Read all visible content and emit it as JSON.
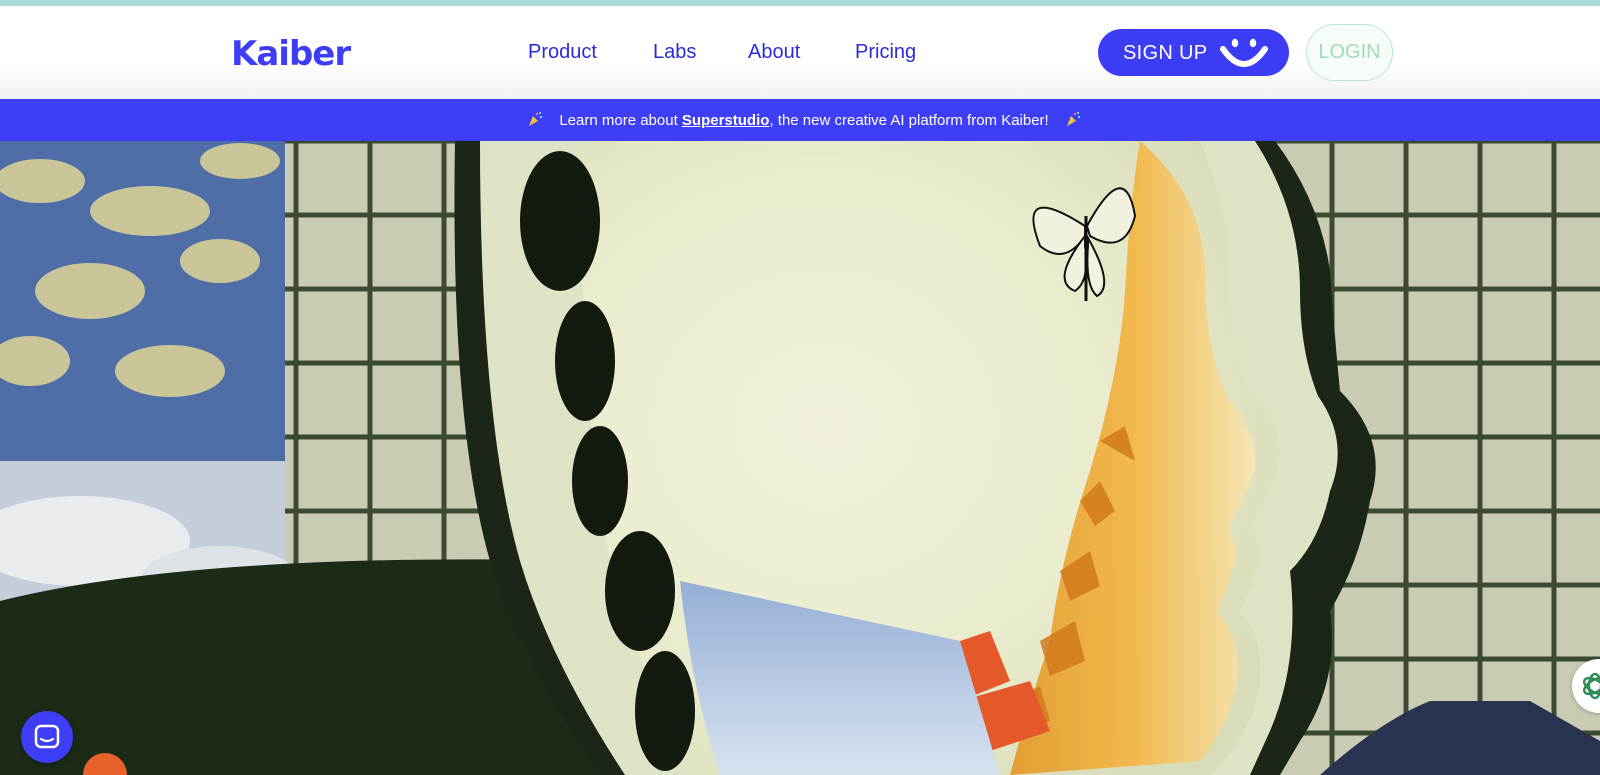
{
  "brand": {
    "logo_text": "Kaiber",
    "accent": "#3d3df5",
    "banner_bg": "#3e3ef6",
    "login_accent": "#9fdcb6"
  },
  "nav": {
    "links": [
      {
        "label": "Product"
      },
      {
        "label": "Labs"
      },
      {
        "label": "About"
      },
      {
        "label": "Pricing"
      }
    ],
    "signup_label": "SIGN UP",
    "login_label": "LOGIN",
    "signup_icon": "smile-icon"
  },
  "banner": {
    "icon": "party-popper-icon",
    "prefix": "Learn more about ",
    "link": "Superstudio",
    "suffix": ", the new creative AI platform from Kaiber!"
  },
  "hero": {
    "image": "collage-profile-butterfly-autumn-leaves"
  },
  "widgets": {
    "chat_icon": "chat-bubble-icon",
    "side_icon": "openai-logo-icon"
  }
}
